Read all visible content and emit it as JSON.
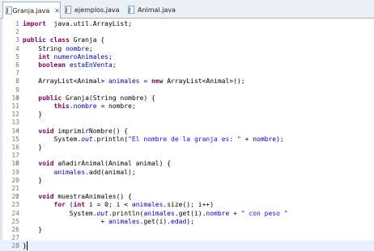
{
  "tabs": [
    {
      "label": "Granja.java",
      "active": true,
      "close": "✕"
    },
    {
      "label": "ejemplos.java",
      "active": false
    },
    {
      "label": "Animal.java",
      "active": false
    }
  ],
  "code_lines": [
    {
      "n": "1",
      "code": [
        [
          "kw",
          "import"
        ],
        [
          "",
          "  java.util.ArrayList;"
        ]
      ]
    },
    {
      "n": "2",
      "code": []
    },
    {
      "n": "3",
      "code": [
        [
          "kw",
          "public"
        ],
        [
          "",
          " "
        ],
        [
          "kw",
          "class"
        ],
        [
          "",
          " Granja {"
        ]
      ]
    },
    {
      "n": "4",
      "code": [
        [
          "",
          "    String "
        ],
        [
          "fld",
          "nombre"
        ],
        [
          "",
          ";"
        ]
      ]
    },
    {
      "n": "5",
      "code": [
        [
          "",
          "    "
        ],
        [
          "kw",
          "int"
        ],
        [
          "",
          " "
        ],
        [
          "fld",
          "numeroAnimales"
        ],
        [
          "",
          ";"
        ]
      ]
    },
    {
      "n": "6",
      "code": [
        [
          "",
          "    "
        ],
        [
          "kw",
          "boolean"
        ],
        [
          "",
          " "
        ],
        [
          "fld",
          "estaEnVenta"
        ],
        [
          "",
          ";"
        ]
      ]
    },
    {
      "n": "7",
      "code": []
    },
    {
      "n": "8",
      "code": [
        [
          "",
          "    ArrayList<Animal> "
        ],
        [
          "fld",
          "animales"
        ],
        [
          "",
          " = "
        ],
        [
          "kw",
          "new"
        ],
        [
          "",
          " ArrayList<Animal>();"
        ]
      ]
    },
    {
      "n": "9",
      "code": []
    },
    {
      "n": "10",
      "fold": "⊖",
      "code": [
        [
          "",
          "    "
        ],
        [
          "kw",
          "public"
        ],
        [
          "",
          " Granja(String nombre) {"
        ]
      ]
    },
    {
      "n": "11",
      "code": [
        [
          "",
          "        "
        ],
        [
          "kw",
          "this"
        ],
        [
          "",
          "."
        ],
        [
          "fld",
          "nombre"
        ],
        [
          "",
          " = nombre;"
        ]
      ]
    },
    {
      "n": "12",
      "code": [
        [
          "",
          "    }"
        ]
      ]
    },
    {
      "n": "13",
      "code": []
    },
    {
      "n": "14",
      "fold": "⊖",
      "code": [
        [
          "",
          "    "
        ],
        [
          "kw",
          "void"
        ],
        [
          "",
          " imprimirNombre() {"
        ]
      ]
    },
    {
      "n": "15",
      "code": [
        [
          "",
          "        System."
        ],
        [
          "fld ital",
          "out"
        ],
        [
          "",
          ".println("
        ],
        [
          "str",
          "\"El nombre de la granja es: \""
        ],
        [
          "",
          " + "
        ],
        [
          "fld",
          "nombre"
        ],
        [
          "",
          ");"
        ]
      ]
    },
    {
      "n": "16",
      "code": [
        [
          "",
          "    }"
        ]
      ]
    },
    {
      "n": "17",
      "code": []
    },
    {
      "n": "18",
      "fold": "⊖",
      "code": [
        [
          "",
          "    "
        ],
        [
          "kw",
          "void"
        ],
        [
          "",
          " añadirAnimal(Animal animal) {"
        ]
      ]
    },
    {
      "n": "19",
      "code": [
        [
          "",
          "        "
        ],
        [
          "fld",
          "animales"
        ],
        [
          "",
          ".add(animal);"
        ]
      ]
    },
    {
      "n": "20",
      "code": [
        [
          "",
          "    }"
        ]
      ]
    },
    {
      "n": "21",
      "code": []
    },
    {
      "n": "22",
      "fold": "⊖",
      "code": [
        [
          "",
          "    "
        ],
        [
          "kw",
          "void"
        ],
        [
          "",
          " muestraAnimales() {"
        ]
      ]
    },
    {
      "n": "23",
      "code": [
        [
          "",
          "        "
        ],
        [
          "kw",
          "for"
        ],
        [
          "",
          " ("
        ],
        [
          "kw",
          "int"
        ],
        [
          "",
          " i = 0; i < "
        ],
        [
          "fld",
          "animales"
        ],
        [
          "",
          ".size(); i++)"
        ]
      ]
    },
    {
      "n": "24",
      "code": [
        [
          "",
          "            System."
        ],
        [
          "fld ital",
          "out"
        ],
        [
          "",
          ".println("
        ],
        [
          "fld",
          "animales"
        ],
        [
          "",
          ".get(i)."
        ],
        [
          "fld",
          "nombre"
        ],
        [
          "",
          " + "
        ],
        [
          "str",
          "\" con peso \""
        ]
      ]
    },
    {
      "n": "25",
      "code": [
        [
          "",
          "                    + "
        ],
        [
          "fld",
          "animales"
        ],
        [
          "",
          ".get(i)."
        ],
        [
          "fld",
          "edad"
        ],
        [
          "",
          ");"
        ]
      ]
    },
    {
      "n": "26",
      "code": [
        [
          "",
          "    }"
        ]
      ]
    },
    {
      "n": "27",
      "code": []
    },
    {
      "n": "28",
      "current": true,
      "code": [
        [
          "",
          "}"
        ]
      ]
    }
  ]
}
